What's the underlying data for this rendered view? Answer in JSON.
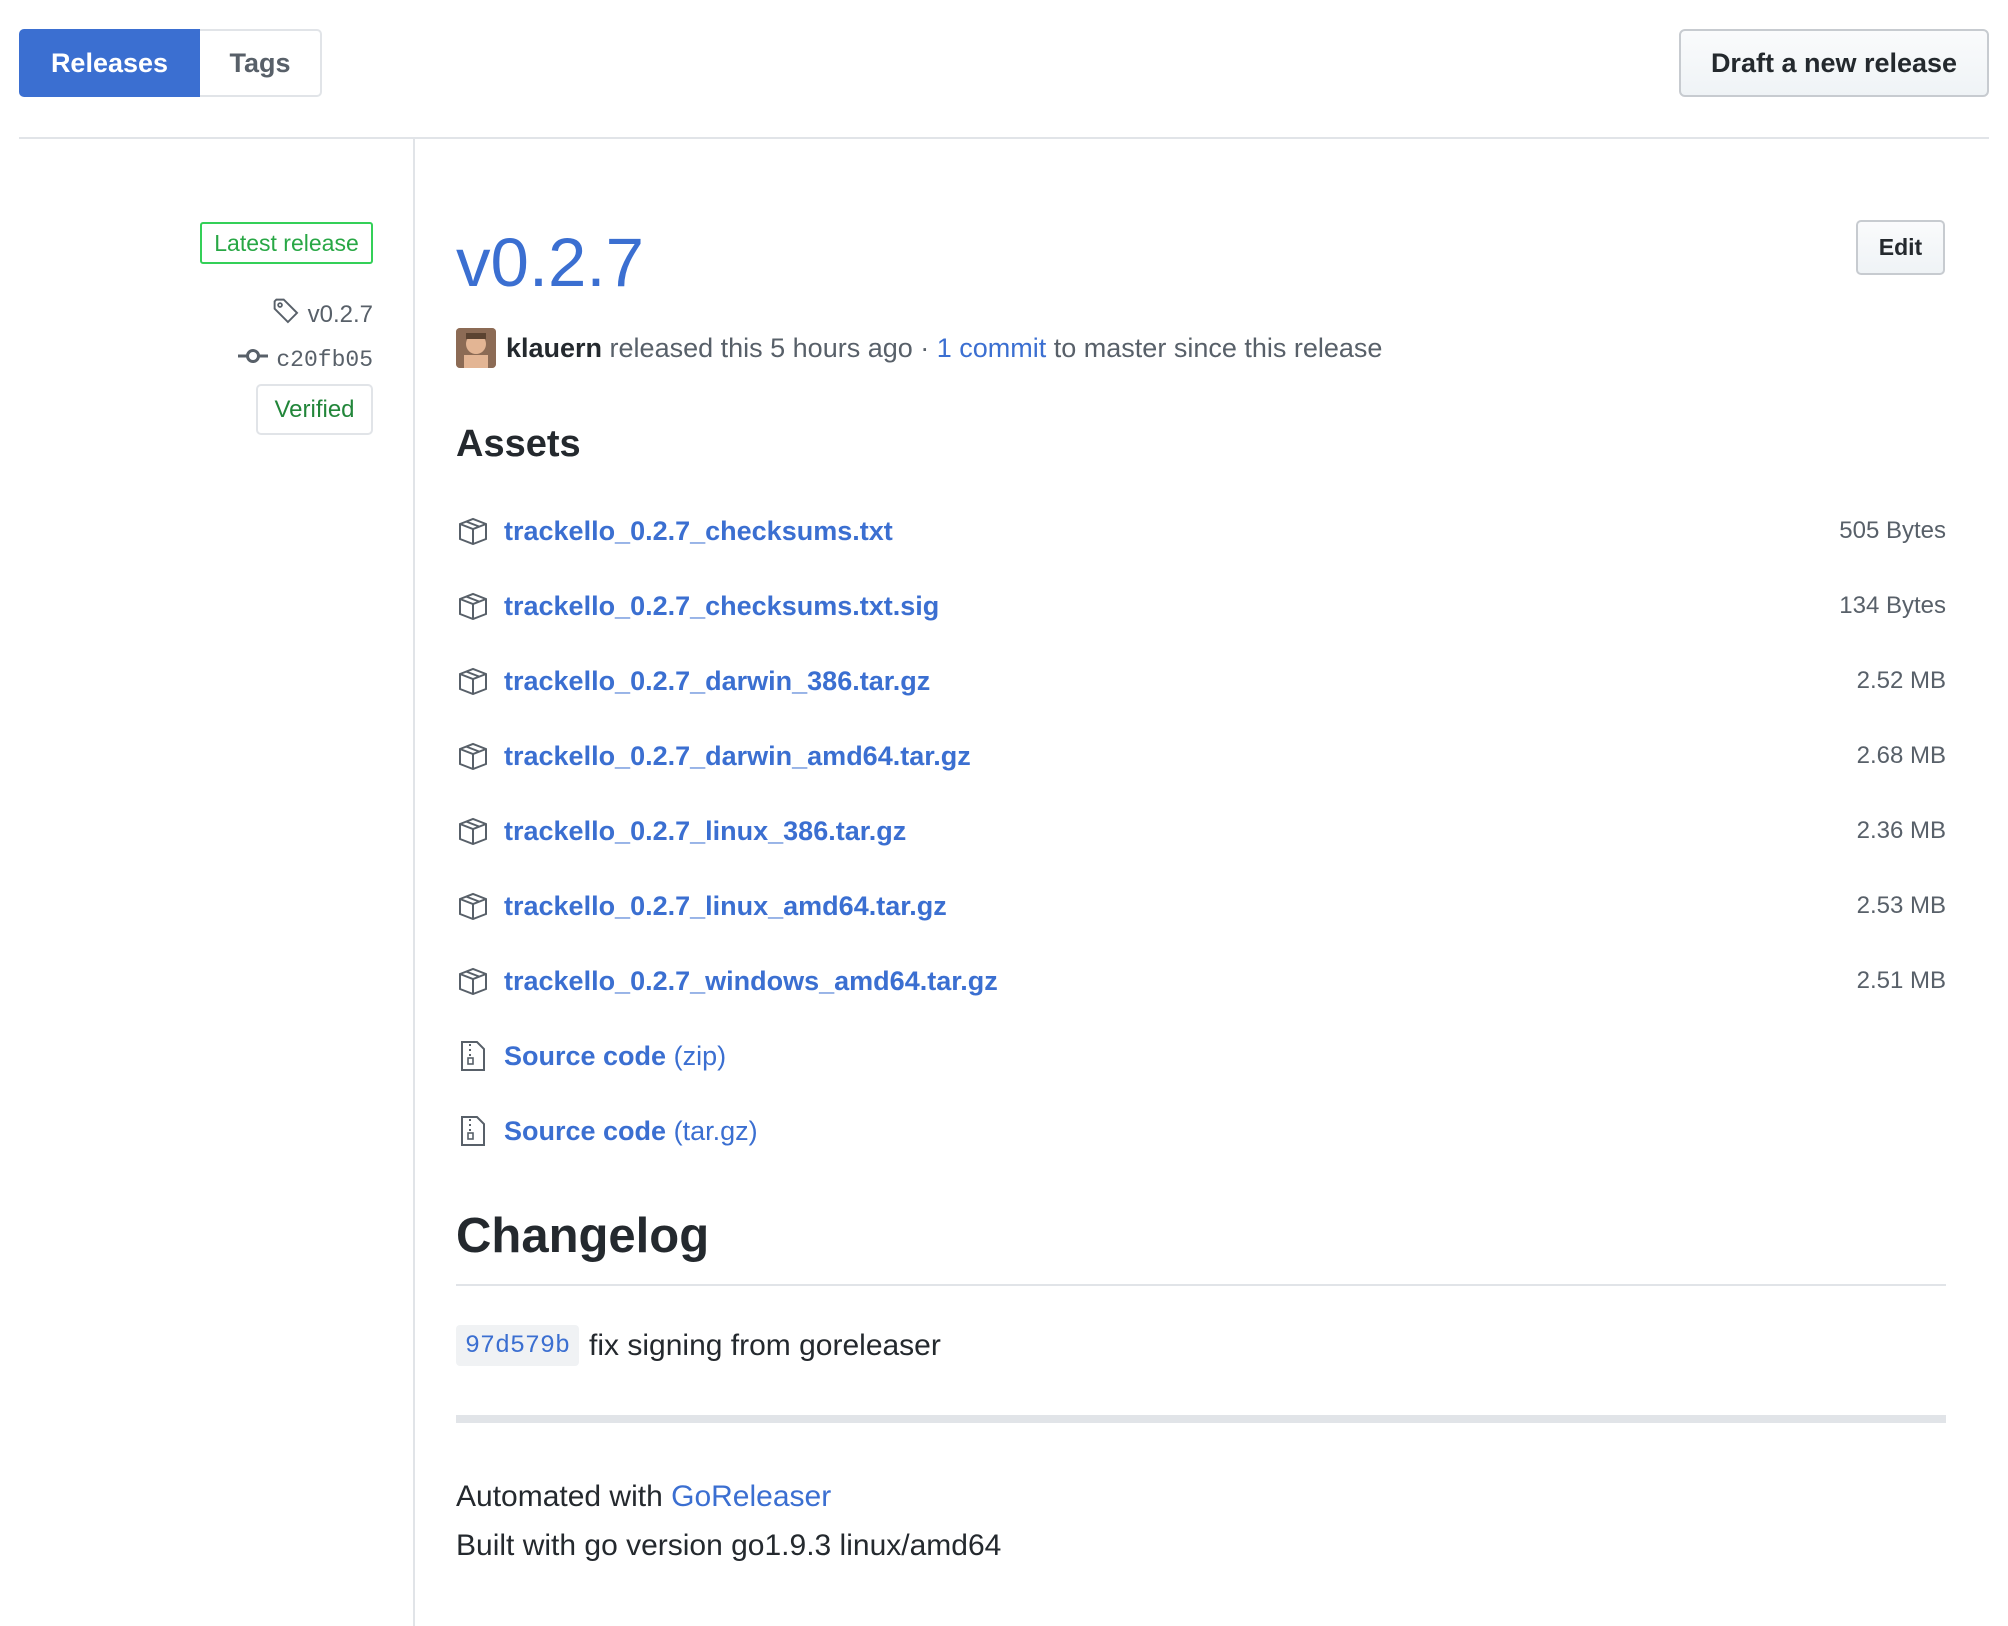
{
  "subnav": {
    "releases_label": "Releases",
    "tags_label": "Tags"
  },
  "draft_label": "Draft a new release",
  "sidebar": {
    "latest_badge": "Latest release",
    "tag": "v0.2.7",
    "commit": "c20fb05",
    "verified": "Verified"
  },
  "release": {
    "title": "v0.2.7",
    "edit_label": "Edit",
    "author": "klauern",
    "released_text": " released this 5 hours ago · ",
    "commits_link": "1 commit",
    "commits_suffix": " to master since this release"
  },
  "assets": {
    "heading": "Assets",
    "items": [
      {
        "name": "trackello_0.2.7_checksums.txt",
        "size": "505 Bytes"
      },
      {
        "name": "trackello_0.2.7_checksums.txt.sig",
        "size": "134 Bytes"
      },
      {
        "name": "trackello_0.2.7_darwin_386.tar.gz",
        "size": "2.52 MB"
      },
      {
        "name": "trackello_0.2.7_darwin_amd64.tar.gz",
        "size": "2.68 MB"
      },
      {
        "name": "trackello_0.2.7_linux_386.tar.gz",
        "size": "2.36 MB"
      },
      {
        "name": "trackello_0.2.7_linux_amd64.tar.gz",
        "size": "2.53 MB"
      },
      {
        "name": "trackello_0.2.7_windows_amd64.tar.gz",
        "size": "2.51 MB"
      }
    ],
    "source": [
      {
        "label": "Source code",
        "format": "(zip)"
      },
      {
        "label": "Source code",
        "format": "(tar.gz)"
      }
    ]
  },
  "changelog": {
    "heading": "Changelog",
    "sha": "97d579b",
    "message": "fix signing from goreleaser",
    "automated_prefix": "Automated with ",
    "automated_link": "GoReleaser",
    "built_with": "Built with go version go1.9.3 linux/amd64"
  }
}
